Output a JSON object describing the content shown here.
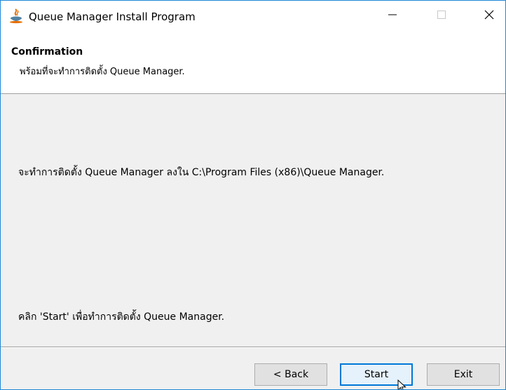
{
  "window": {
    "title": "Queue Manager Install Program",
    "controls": {
      "minimize_icon": "minimize-icon",
      "maximize_icon": "maximize-icon",
      "close_icon": "close-icon"
    }
  },
  "header": {
    "title": "Confirmation",
    "subtitle": "พร้อมที่จะทำการติดตั้ง Queue Manager."
  },
  "body": {
    "install_path_text": "จะทำการติดตั้ง Queue Manager ลงใน C:\\Program Files (x86)\\Queue Manager.",
    "click_start_text": "คลิก 'Start' เพื่อทำการติดตั้ง Queue Manager."
  },
  "buttons": {
    "back": "< Back",
    "start": "Start",
    "exit": "Exit"
  },
  "colors": {
    "accent": "#0078d7",
    "window_border": "#1e88d8",
    "background": "#f0f0f0"
  }
}
